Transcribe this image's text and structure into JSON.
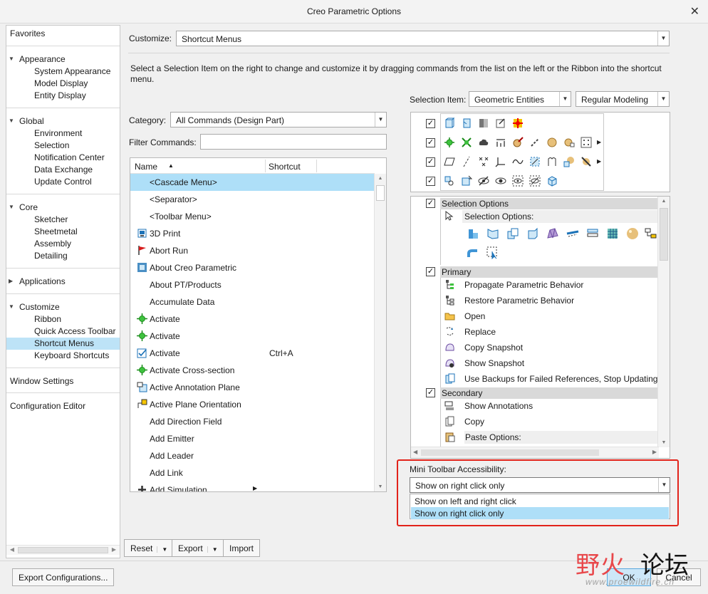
{
  "window": {
    "title": "Creo Parametric Options"
  },
  "nav": {
    "favorites": "Favorites",
    "appearance": {
      "label": "Appearance",
      "items": [
        "System Appearance",
        "Model Display",
        "Entity Display"
      ]
    },
    "global": {
      "label": "Global",
      "items": [
        "Environment",
        "Selection",
        "Notification Center",
        "Data Exchange",
        "Update Control"
      ]
    },
    "core": {
      "label": "Core",
      "items": [
        "Sketcher",
        "Sheetmetal",
        "Assembly",
        "Detailing"
      ]
    },
    "applications": "Applications",
    "customize": {
      "label": "Customize",
      "items": [
        "Ribbon",
        "Quick Access Toolbar",
        "Shortcut Menus",
        "Keyboard Shortcuts"
      ]
    },
    "window_settings": "Window Settings",
    "config_editor": "Configuration Editor",
    "selected": "Shortcut Menus"
  },
  "customize": {
    "label": "Customize:",
    "value": "Shortcut Menus"
  },
  "description": "Select a Selection Item on the right to change and customize it by dragging commands from the list on the left or the Ribbon into the shortcut menu.",
  "category": {
    "label": "Category:",
    "value": "All Commands (Design Part)"
  },
  "filter": {
    "label": "Filter Commands:",
    "value": ""
  },
  "commands": {
    "col_name": "Name",
    "col_shortcut": "Shortcut",
    "rows": [
      {
        "name": "<Cascade Menu>",
        "shortcut": "",
        "icon": "none"
      },
      {
        "name": "<Separator>",
        "shortcut": "",
        "icon": "none"
      },
      {
        "name": "<Toolbar Menu>",
        "shortcut": "",
        "icon": "none"
      },
      {
        "name": "3D Print",
        "shortcut": "",
        "icon": "3d-print-icon"
      },
      {
        "name": "Abort Run",
        "shortcut": "",
        "icon": "red-flag-icon"
      },
      {
        "name": "About Creo Parametric",
        "shortcut": "",
        "icon": "creo-logo-icon"
      },
      {
        "name": "About PT/Products",
        "shortcut": "",
        "icon": "none"
      },
      {
        "name": "Accumulate Data",
        "shortcut": "",
        "icon": "none"
      },
      {
        "name": "Activate",
        "shortcut": "",
        "icon": "activate-icon"
      },
      {
        "name": "Activate",
        "shortcut": "",
        "icon": "activate-icon"
      },
      {
        "name": "Activate",
        "shortcut": "Ctrl+A",
        "icon": "activate-check-icon"
      },
      {
        "name": "Activate Cross-section",
        "shortcut": "",
        "icon": "activate-icon"
      },
      {
        "name": "Active Annotation Plane",
        "shortcut": "",
        "icon": "annotation-plane-icon"
      },
      {
        "name": "Active Plane Orientation",
        "shortcut": "",
        "icon": "plane-orientation-icon"
      },
      {
        "name": "Add Direction Field",
        "shortcut": "",
        "icon": "none"
      },
      {
        "name": "Add Emitter",
        "shortcut": "",
        "icon": "none"
      },
      {
        "name": "Add Leader",
        "shortcut": "",
        "icon": "none"
      },
      {
        "name": "Add Link",
        "shortcut": "",
        "icon": "none"
      },
      {
        "name": "Add Simulation",
        "shortcut": "",
        "icon": "plus-icon"
      }
    ]
  },
  "buttons": {
    "reset": "Reset",
    "export": "Export",
    "import": "Import",
    "export_config": "Export Configurations...",
    "ok": "OK",
    "cancel": "Cancel"
  },
  "selection_item": {
    "label": "Selection Item:",
    "value": "Geometric Entities",
    "mode": "Regular Modeling"
  },
  "options_tree": {
    "selection_options_group": "Selection Options",
    "selection_options_label": "Selection Options:",
    "primary_group": "Primary",
    "primary_items": [
      "Propagate Parametric Behavior",
      "Restore Parametric Behavior",
      "Open",
      "Replace",
      "Copy Snapshot",
      "Show Snapshot",
      "Use Backups for Failed References, Stop Updating"
    ],
    "secondary_group": "Secondary",
    "secondary_items": [
      "Show Annotations",
      "Copy",
      "Paste Options:"
    ]
  },
  "mini_toolbar": {
    "label": "Mini Toolbar Accessibility:",
    "value": "Show on right click only",
    "options": [
      "Show on left and right click",
      "Show on right click only"
    ],
    "selected_index": 1
  },
  "watermark": {
    "cn_red": "野火",
    "cn_black": "论坛",
    "url": "www.proewildfire.cn"
  },
  "colors": {
    "selection": "#aedff8",
    "highlight_box": "#e2231a",
    "green_icon": "#1a8c1a",
    "watermark_red": "#e8474a"
  }
}
